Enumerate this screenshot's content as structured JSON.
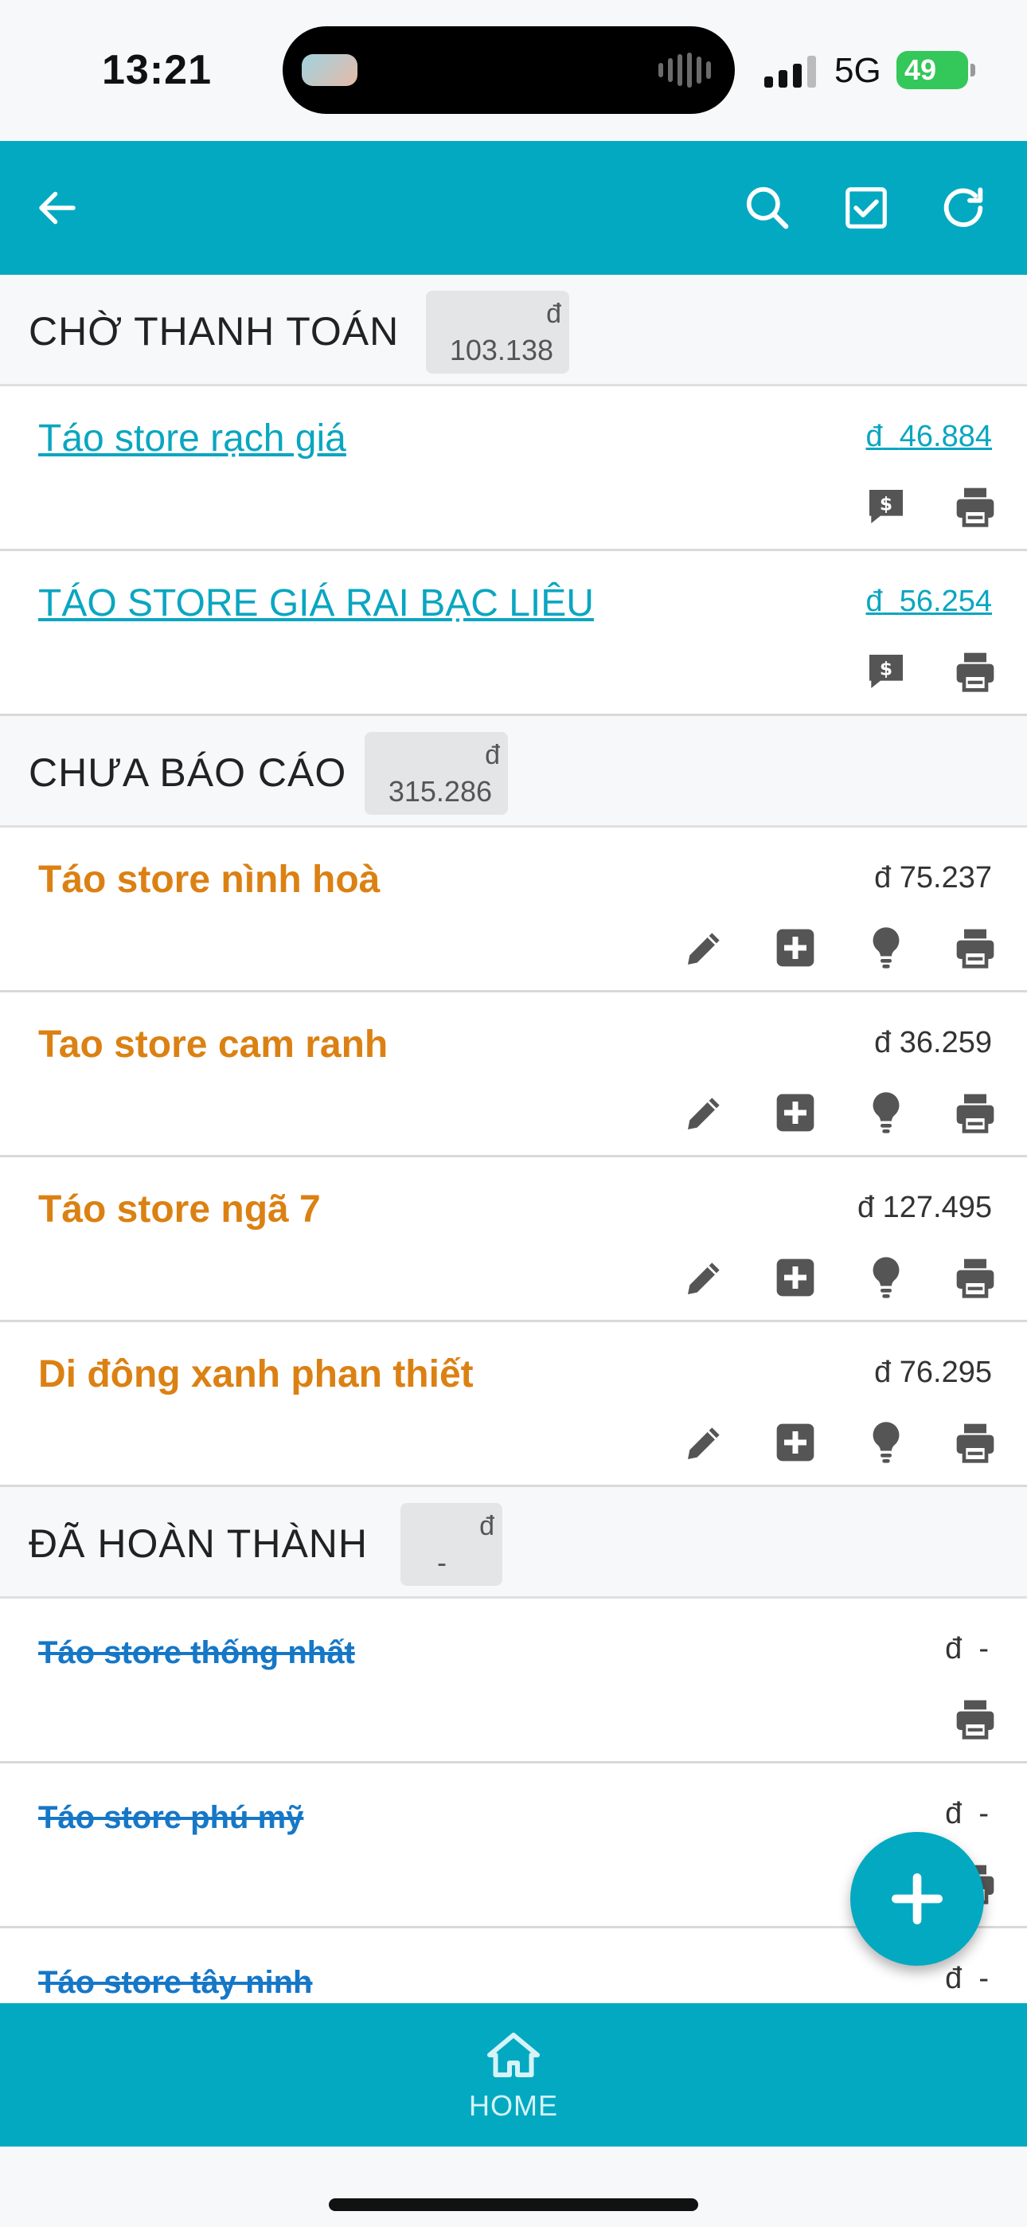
{
  "status": {
    "time": "13:21",
    "network": "5G",
    "battery": "49"
  },
  "toolbar": {
    "back_icon": "arrow-left-icon",
    "search_icon": "search-icon",
    "check_icon": "checkbox-icon",
    "refresh_icon": "refresh-icon"
  },
  "sections": {
    "pending": {
      "title": "CHỜ THANH TOÁN",
      "currency": "đ",
      "total": "103.138"
    },
    "unreported": {
      "title": "CHƯA BÁO CÁO",
      "currency": "đ",
      "total": "315.286"
    },
    "completed": {
      "title": "ĐÃ HOÀN THÀNH",
      "currency": "đ",
      "total": "-"
    }
  },
  "pending_items": [
    {
      "name": "Táo store rạch giá",
      "currency": "đ",
      "amount": "46.884"
    },
    {
      "name": "TÁO STORE GIÁ RAI BẠC LIÊU",
      "currency": "đ",
      "amount": "56.254"
    }
  ],
  "unreported_items": [
    {
      "name": "Táo store nình hoà",
      "amount": "đ 75.237"
    },
    {
      "name": "Tao store cam ranh",
      "amount": "đ 36.259"
    },
    {
      "name": "Táo store ngã 7",
      "amount": "đ 127.495"
    },
    {
      "name": "Di đông xanh phan thiết",
      "amount": "đ 76.295"
    }
  ],
  "completed_items": [
    {
      "name": "Táo store thống nhất",
      "amount": "đ  -"
    },
    {
      "name": "Táo store phú mỹ",
      "amount": "đ  -"
    },
    {
      "name": "Táo store tây ninh",
      "amount": "đ  -"
    }
  ],
  "bottom_nav": {
    "home_label": "HOME"
  },
  "colors": {
    "primary": "#02a9c1",
    "orange": "#db8113",
    "done_blue": "#1677c7"
  }
}
